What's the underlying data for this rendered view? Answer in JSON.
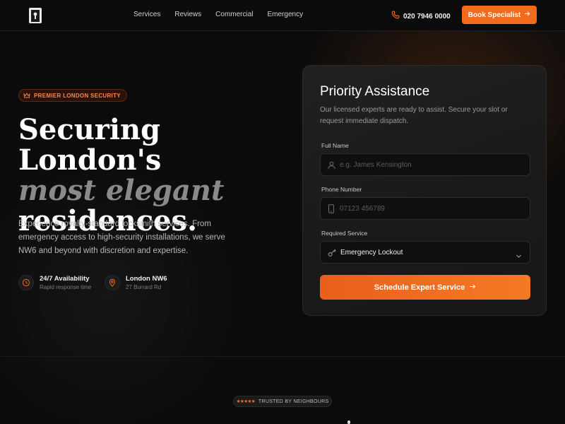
{
  "nav": {
    "links": [
      "Services",
      "Reviews",
      "Commercial",
      "Emergency"
    ],
    "phone": "020 7946 0000",
    "book_label": "Book Specialist"
  },
  "hero": {
    "badge": "PREMIER LONDON SECURITY",
    "title_line1": "Securing London's",
    "title_line2": "most elegant",
    "title_line3": "residences.",
    "description": "Experience royalty-standard locksmith services. From emergency access to high-security installations, we serve NW6 and beyond with discretion and expertise.",
    "features": [
      {
        "title": "24/7 Availability",
        "subtitle": "Rapid response time",
        "icon": "clock-icon"
      },
      {
        "title": "London NW6",
        "subtitle": "27 Burrard Rd",
        "icon": "location-pin-icon"
      }
    ]
  },
  "form": {
    "title": "Priority Assistance",
    "subtitle": "Our licensed experts are ready to assist. Secure your slot or request immediate dispatch.",
    "name_label": "Full Name",
    "name_placeholder": "e.g. James Kensington",
    "phone_label": "Phone Number",
    "phone_placeholder": "07123 456789",
    "service_label": "Required Service",
    "service_value": "Emergency Lockout",
    "submit_label": "Schedule Expert Service"
  },
  "trusted": {
    "label": "TRUSTED BY NEIGHBOURS",
    "stars": "★★★★★"
  },
  "colors": {
    "accent": "#f26a1b",
    "background": "#0b0b0b",
    "card": "#1c1b1a"
  }
}
